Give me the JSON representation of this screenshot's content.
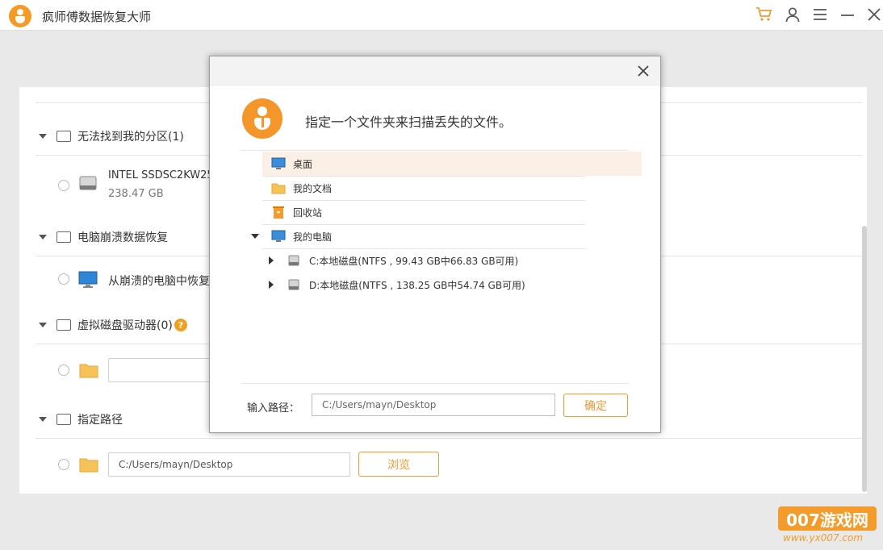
{
  "app": {
    "title": "疯师傅数据恢复大师"
  },
  "titlebar_icons": [
    "cart-icon",
    "user-icon",
    "menu-icon",
    "minimize-icon",
    "close-icon"
  ],
  "colors": {
    "accent": "#f09a37",
    "logo": "#f5962a",
    "selected_row_bg": "#fcefe6"
  },
  "background": {
    "sections": [
      {
        "label": "无法找到我的分区(1)"
      },
      {
        "label": "电脑崩溃数据恢复"
      },
      {
        "label": "虚拟磁盘驱动器(0)"
      },
      {
        "label": "指定路径"
      }
    ],
    "drive_name": "INTEL SSDSC2KW25",
    "drive_size": "238.47 GB",
    "crash_item": "从崩溃的电脑中恢复",
    "path_value": "C:/Users/mayn/Desktop",
    "browse_label": "浏览"
  },
  "dialog": {
    "instruction": "指定一个文件夹来扫描丢失的文件。",
    "tree": [
      {
        "label": "桌面",
        "icon": "desktop-icon",
        "selected": true
      },
      {
        "label": "我的文档",
        "icon": "folder-icon"
      },
      {
        "label": "回收站",
        "icon": "recycle-bin-icon"
      },
      {
        "label": "我的电脑",
        "icon": "computer-icon",
        "expanded": true
      },
      {
        "label": "C:本地磁盘(NTFS , 99.43 GB中66.83 GB可用)",
        "icon": "disk-icon"
      },
      {
        "label": "D:本地磁盘(NTFS , 138.25 GB中54.74 GB可用)",
        "icon": "disk-icon"
      }
    ],
    "path_label": "输入路径：",
    "path_value": "C:/Users/mayn/Desktop",
    "ok_label": "确定"
  },
  "watermark": {
    "main": "007游戏网",
    "sub": "www.yx007.com"
  }
}
